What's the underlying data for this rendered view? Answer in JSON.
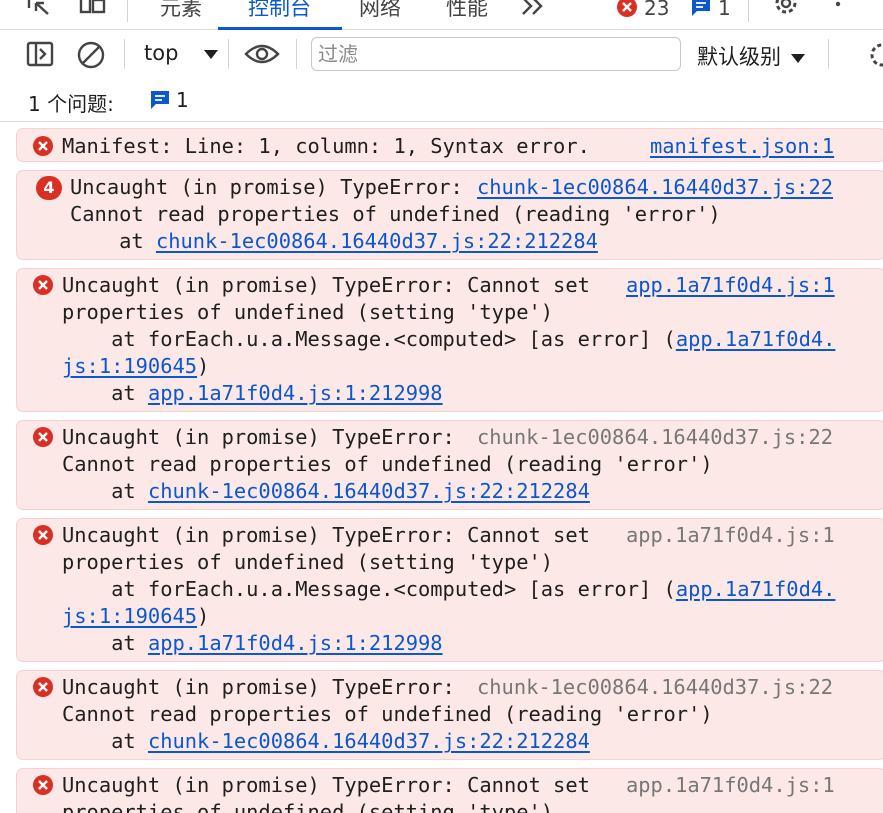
{
  "tabs": [
    {
      "label": "元素"
    },
    {
      "label": "控制台",
      "active": true
    },
    {
      "label": "网络"
    },
    {
      "label": "性能"
    }
  ],
  "counters": {
    "errors": "23",
    "messages": "1"
  },
  "toolbar": {
    "context": "top",
    "filter_placeholder": "过滤",
    "level": "默认级别"
  },
  "issues": {
    "label": "1 个问题:",
    "count": "1"
  },
  "colors": {
    "accent": "#0b57d0",
    "error": "#d93025",
    "error_bg": "#fce8e6"
  },
  "messages": [
    {
      "repeat": "",
      "lines": [
        {
          "text": "Manifest: Line: 1, column: 1, Syntax error."
        }
      ],
      "source": "manifest.json:1",
      "source_linked": true
    },
    {
      "repeat": "4",
      "lines": [
        {
          "text": "Uncaught (in promise) TypeError: "
        },
        {
          "text": "Cannot read properties of undefined (reading 'error')"
        },
        {
          "text": "    at ",
          "link": "chunk-1ec00864.16440d37.js:22:212284"
        }
      ],
      "source": "chunk-1ec00864.16440d37.js:22",
      "source_linked": true
    },
    {
      "repeat": "",
      "lines": [
        {
          "text": "Uncaught (in promise) TypeError: Cannot set"
        },
        {
          "text": "properties of undefined (setting 'type')"
        },
        {
          "text": "    at forEach.u.a.Message.<computed> [as error] (",
          "link": "app.1a71f0d4."
        },
        {
          "text": "",
          "link": "js:1:190645",
          "suffix": ")"
        },
        {
          "text": "    at ",
          "link": "app.1a71f0d4.js:1:212998"
        }
      ],
      "source": "app.1a71f0d4.js:1",
      "source_linked": true
    },
    {
      "repeat": "",
      "lines": [
        {
          "text": "Uncaught (in promise) TypeError: "
        },
        {
          "text": "Cannot read properties of undefined (reading 'error')"
        },
        {
          "text": "    at ",
          "link": "chunk-1ec00864.16440d37.js:22:212284"
        }
      ],
      "source": "chunk-1ec00864.16440d37.js:22",
      "source_linked": false
    },
    {
      "repeat": "",
      "lines": [
        {
          "text": "Uncaught (in promise) TypeError: Cannot set"
        },
        {
          "text": "properties of undefined (setting 'type')"
        },
        {
          "text": "    at forEach.u.a.Message.<computed> [as error] (",
          "link": "app.1a71f0d4."
        },
        {
          "text": "",
          "link": "js:1:190645",
          "suffix": ")"
        },
        {
          "text": "    at ",
          "link": "app.1a71f0d4.js:1:212998"
        }
      ],
      "source": "app.1a71f0d4.js:1",
      "source_linked": false
    },
    {
      "repeat": "",
      "lines": [
        {
          "text": "Uncaught (in promise) TypeError: "
        },
        {
          "text": "Cannot read properties of undefined (reading 'error')"
        },
        {
          "text": "    at ",
          "link": "chunk-1ec00864.16440d37.js:22:212284"
        }
      ],
      "source": "chunk-1ec00864.16440d37.js:22",
      "source_linked": false
    },
    {
      "repeat": "",
      "lines": [
        {
          "text": "Uncaught (in promise) TypeError: Cannot set"
        },
        {
          "text": "properties of undefined (setting 'type')"
        }
      ],
      "source": "app.1a71f0d4.js:1",
      "source_linked": false
    }
  ]
}
